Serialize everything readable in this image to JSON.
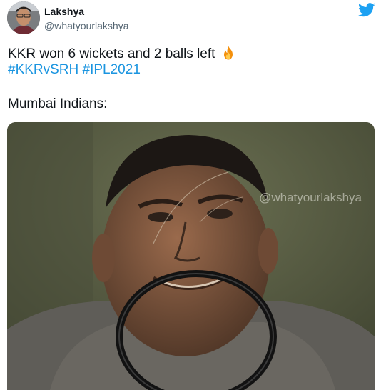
{
  "user": {
    "name": "Lakshya",
    "handle": "@whatyourlakshya"
  },
  "tweet": {
    "line1_text": "KKR won 6 wickets and 2 balls left",
    "hashtags": [
      "#KKRvSRH",
      "#IPL2021"
    ],
    "line3_text": "Mumbai Indians:"
  },
  "media": {
    "watermark": "@whatyourlakshya"
  },
  "icons": {
    "brand": "twitter-bird-icon",
    "emoji": "fire-icon"
  },
  "colors": {
    "text": "#0f1419",
    "secondary": "#536471",
    "hashtag": "#1b95e0",
    "twitter_blue": "#1da1f2"
  }
}
